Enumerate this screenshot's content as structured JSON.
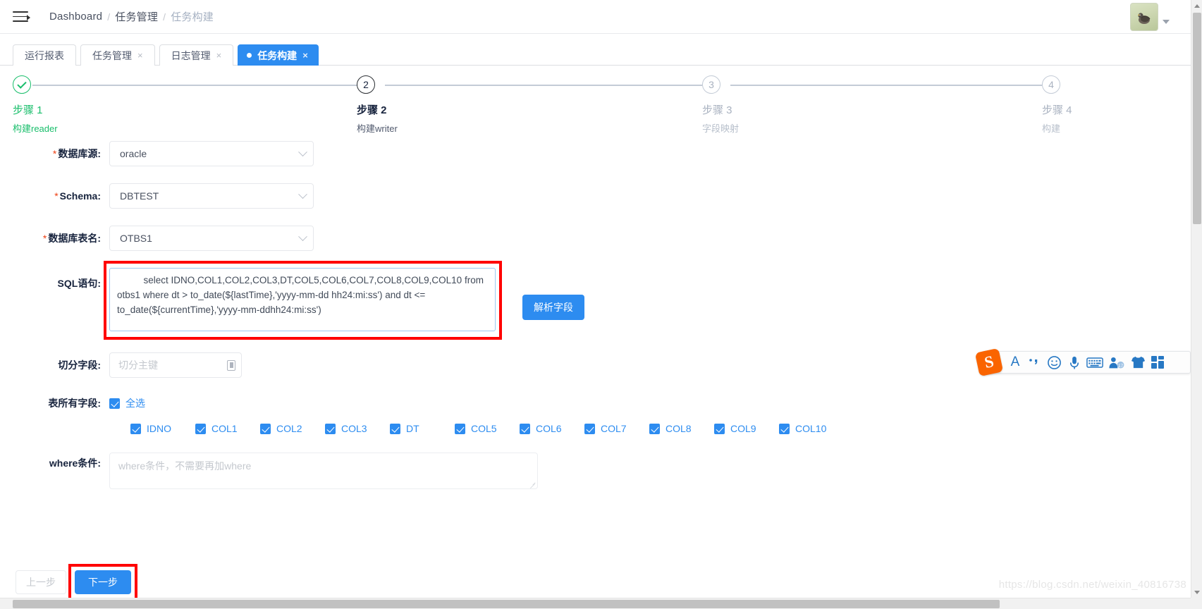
{
  "header": {
    "menu_icon": "hamburger-icon",
    "breadcrumb": [
      "Dashboard",
      "任务管理",
      "任务构建"
    ],
    "separator": "/",
    "avatar_icon": "avatar-bird"
  },
  "tabs": [
    {
      "label": "运行报表",
      "closable": false,
      "active": false
    },
    {
      "label": "任务管理",
      "closable": true,
      "active": false,
      "close": "×"
    },
    {
      "label": "日志管理",
      "closable": true,
      "active": false,
      "close": "×"
    },
    {
      "label": "任务构建",
      "closable": true,
      "active": true,
      "close": "×"
    }
  ],
  "steps": [
    {
      "index": "1",
      "title": "步骤 1",
      "sub": "构建reader",
      "state": "done"
    },
    {
      "index": "2",
      "title": "步骤 2",
      "sub": "构建writer",
      "state": "current"
    },
    {
      "index": "3",
      "title": "步骤 3",
      "sub": "字段映射",
      "state": "wait"
    },
    {
      "index": "4",
      "title": "步骤 4",
      "sub": "构建",
      "state": "wait"
    }
  ],
  "form": {
    "datasource": {
      "label": "数据库源:",
      "required": true,
      "value": "oracle"
    },
    "schema": {
      "label": "Schema:",
      "required": true,
      "value": "DBTEST"
    },
    "table": {
      "label": "数据库表名:",
      "required": true,
      "value": "OTBS1"
    },
    "sql": {
      "label": "SQL语句:",
      "value": "          select IDNO,COL1,COL2,COL3,DT,COL5,COL6,COL7,COL8,COL9,COL10 from otbs1 where dt > to_date(${lastTime},'yyyy-mm-dd hh24:mi:ss') and dt <= to_date(${currentTime},'yyyy-mm-ddhh24:mi:ss')",
      "parse_button": "解析字段"
    },
    "split_field": {
      "label": "切分字段:",
      "placeholder": "切分主键",
      "value": ""
    },
    "all_fields": {
      "label": "表所有字段:",
      "select_all_label": "全选",
      "select_all_checked": true
    },
    "columns": [
      {
        "name": "IDNO",
        "checked": true
      },
      {
        "name": "COL1",
        "checked": true
      },
      {
        "name": "COL2",
        "checked": true
      },
      {
        "name": "COL3",
        "checked": true
      },
      {
        "name": "DT",
        "checked": true
      },
      {
        "name": "COL5",
        "checked": true
      },
      {
        "name": "COL6",
        "checked": true
      },
      {
        "name": "COL7",
        "checked": true
      },
      {
        "name": "COL8",
        "checked": true
      },
      {
        "name": "COL9",
        "checked": true
      },
      {
        "name": "COL10",
        "checked": true
      }
    ],
    "where": {
      "label": "where条件:",
      "placeholder": "where条件，不需要再加where",
      "value": ""
    }
  },
  "footer": {
    "prev": "上一步",
    "next": "下一步"
  },
  "ime": {
    "name": "sogou-input-method",
    "logo": "S",
    "items": [
      {
        "icon": "letter-a-icon",
        "glyph": "A"
      },
      {
        "icon": "punctuation-icon",
        "glyph": "·,"
      },
      {
        "icon": "emoji-icon",
        "glyph": "☺"
      },
      {
        "icon": "microphone-icon",
        "glyph": "🎤"
      },
      {
        "icon": "soft-keyboard-icon",
        "glyph": "⌨"
      },
      {
        "icon": "user-icon",
        "glyph": "👤"
      },
      {
        "icon": "skin-icon",
        "glyph": "👕"
      },
      {
        "icon": "toolbox-grid-icon",
        "glyph": "▦"
      }
    ]
  },
  "watermark": "https://blog.csdn.net/weixin_40816738",
  "colors": {
    "primary": "#2d8cf0",
    "success": "#19be6b",
    "danger": "#ed4014",
    "highlight_box": "#ff0000",
    "text": "#17233d",
    "muted": "#a9b2c0"
  }
}
